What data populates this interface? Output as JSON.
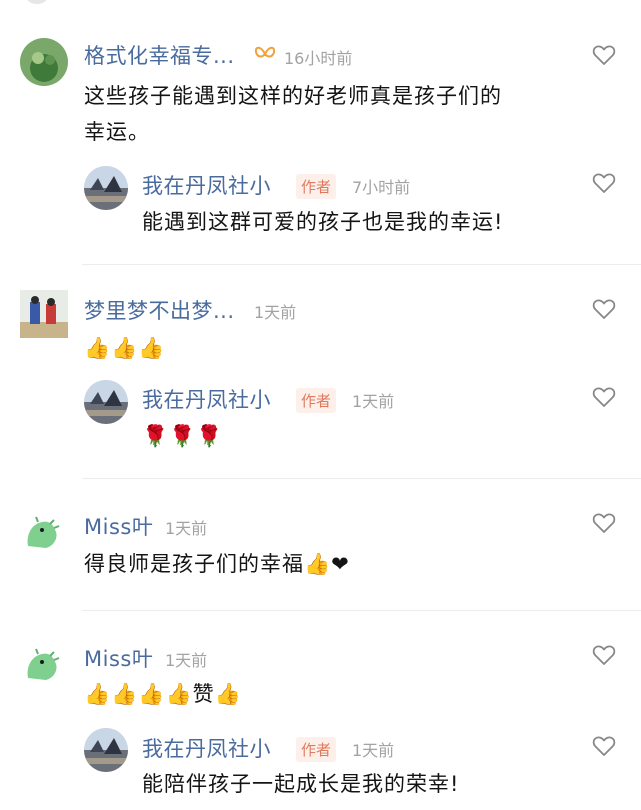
{
  "comments": [
    {
      "username": "格式化幸福专...",
      "time": "16小时前",
      "text_line1": "这些孩子能遇到这样的好老师真是孩子们的",
      "text_line2": "幸运。",
      "reply": {
        "username": "我在丹凤社小",
        "badge": "作者",
        "time": "7小时前",
        "text": "能遇到这群可爱的孩子也是我的幸运!"
      }
    },
    {
      "username": "梦里梦不出梦...",
      "time": "1天前",
      "text": "👍👍👍",
      "reply": {
        "username": "我在丹凤社小",
        "badge": "作者",
        "time": "1天前",
        "text": "🌹🌹🌹"
      }
    },
    {
      "username": "Miss叶",
      "time": "1天前",
      "text": "得良师是孩子们的幸福👍❤"
    },
    {
      "username": "Miss叶",
      "time": "1天前",
      "text": "👍👍👍👍赞👍",
      "reply": {
        "username": "我在丹凤社小",
        "badge": "作者",
        "time": "1天前",
        "text": "能陪伴孩子一起成长是我的荣幸!"
      }
    }
  ],
  "icons": {
    "like": "heart-outline-icon",
    "vip": "butterfly-icon"
  }
}
